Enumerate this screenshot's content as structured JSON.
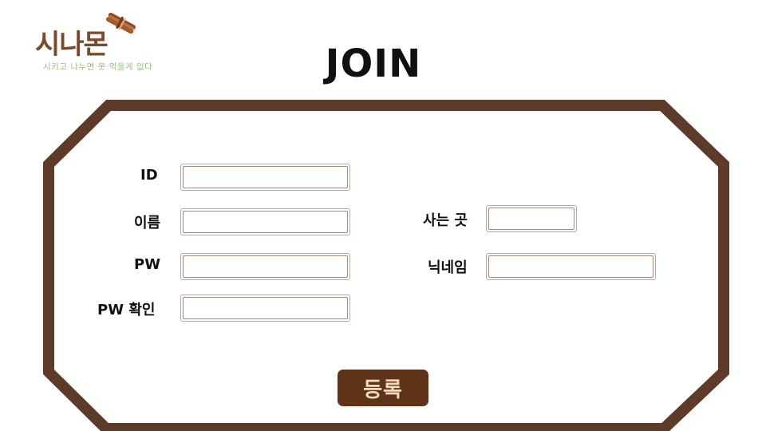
{
  "brand": {
    "name": "시나몬",
    "slogan": "시키고 나누면 못 먹을게 없다",
    "colors": {
      "logo": "#7a4a2c",
      "slogan": "#9cbf7a",
      "frame": "#5e3a2a",
      "button": "#5e3318",
      "button_text": "#f4dcc0"
    }
  },
  "page": {
    "title": "JOIN"
  },
  "form": {
    "id_label": "ID",
    "name_label": "이름",
    "pw_label": "PW",
    "pw_confirm_label": "PW  확인",
    "address_label": "사는 곳",
    "nickname_label": "닉네임",
    "id_value": "",
    "name_value": "",
    "pw_value": "",
    "pw_confirm_value": "",
    "address_value": "",
    "nickname_value": "",
    "submit_label": "등록"
  },
  "icons": {
    "logo_mark": "cinnamon-sticks-icon"
  }
}
